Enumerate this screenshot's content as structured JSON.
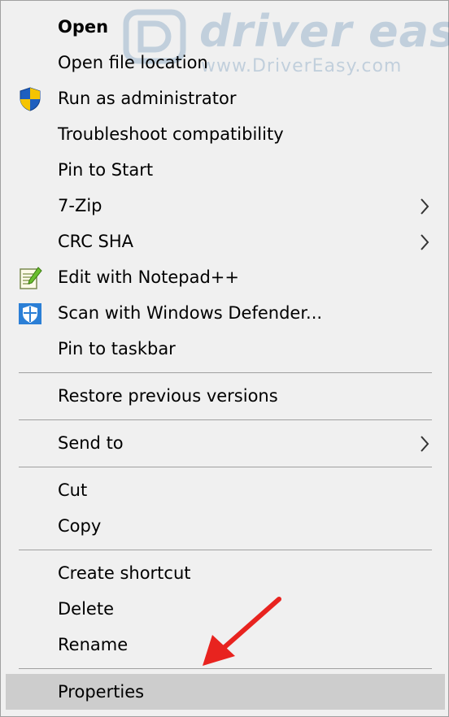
{
  "watermark": {
    "brand": "driver easy",
    "url": "www.DriverEasy.com"
  },
  "menu": {
    "items": [
      {
        "label": "Open",
        "bold": true
      },
      {
        "label": "Open file location"
      },
      {
        "label": "Run as administrator",
        "icon": "uac-shield-icon"
      },
      {
        "label": "Troubleshoot compatibility"
      },
      {
        "label": "Pin to Start"
      },
      {
        "label": "7-Zip",
        "submenu": true
      },
      {
        "label": "CRC SHA",
        "submenu": true
      },
      {
        "label": "Edit with Notepad++",
        "icon": "notepad-plus-plus-icon"
      },
      {
        "label": "Scan with Windows Defender...",
        "icon": "windows-defender-icon"
      },
      {
        "label": "Pin to taskbar"
      },
      {
        "label": "Restore previous versions"
      },
      {
        "label": "Send to",
        "submenu": true
      },
      {
        "label": "Cut"
      },
      {
        "label": "Copy"
      },
      {
        "label": "Create shortcut"
      },
      {
        "label": "Delete"
      },
      {
        "label": "Rename"
      },
      {
        "label": "Properties",
        "highlighted": true
      }
    ]
  },
  "colors": {
    "menu_bg": "#f0f0f0",
    "highlight_bg": "#cdcdcd",
    "separator": "#a0a0a0",
    "arrow": "#e8231f",
    "watermark_blue": "#1f5e97"
  }
}
